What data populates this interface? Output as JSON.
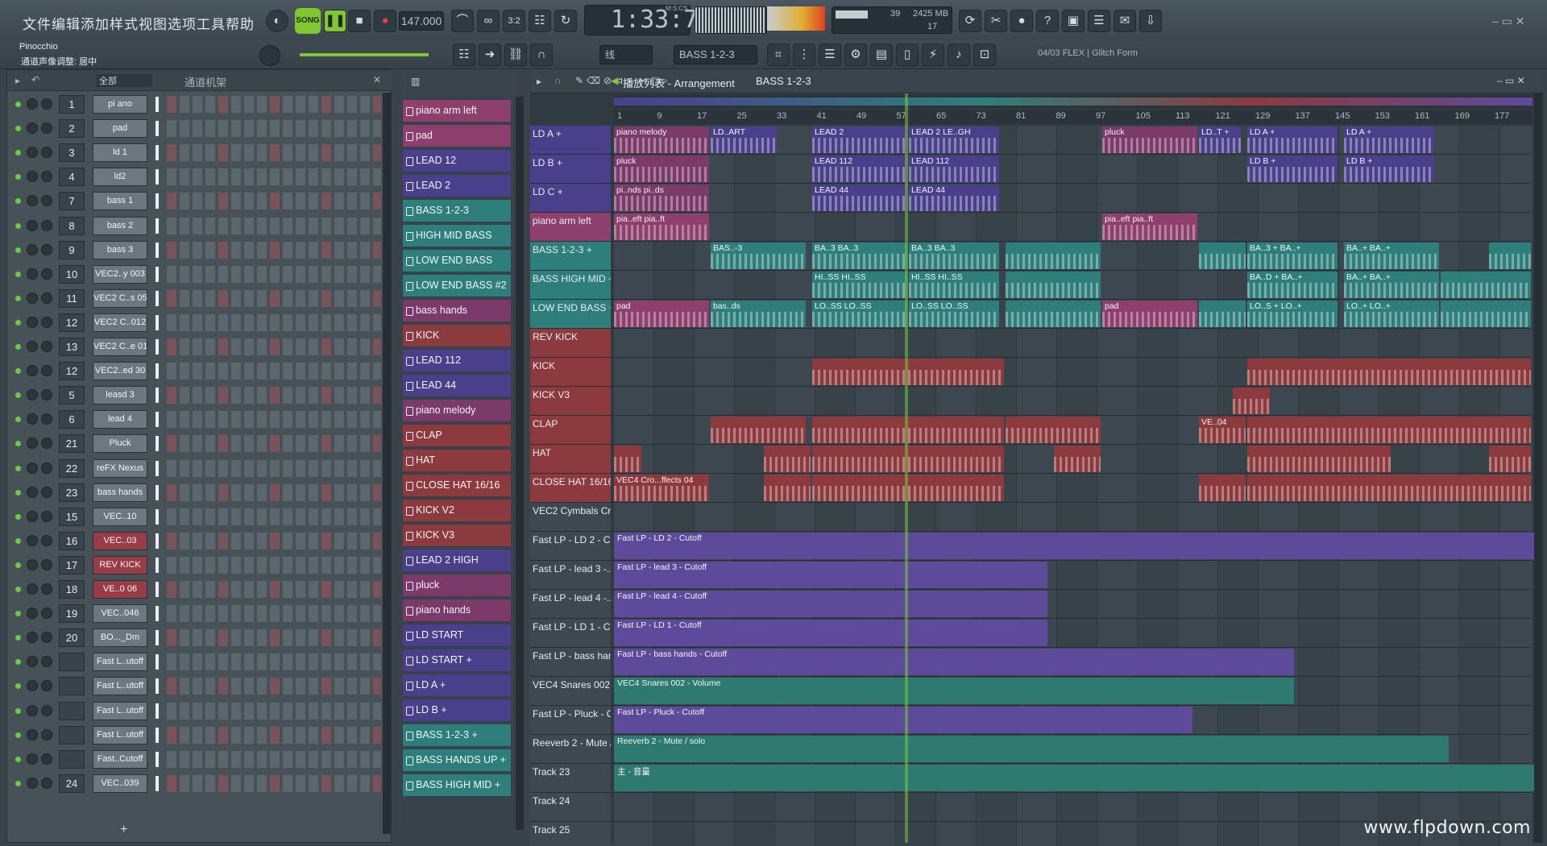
{
  "menu": [
    "文件",
    "编辑",
    "添加",
    "样式",
    "视图",
    "选项",
    "工具",
    "帮助"
  ],
  "transport": {
    "mode": "SONG",
    "tempo": "147.000",
    "time": "1:33:73",
    "time_label": "M:S:CS",
    "cpu": "39",
    "ram": "2425 MB",
    "voices": "17"
  },
  "project": {
    "name": "Pinocchio",
    "hint": "通道声像调整: 居中"
  },
  "toolbar2": {
    "snap": "线",
    "pattern": "BASS 1-2-3",
    "news": "04/03  FLEX | Glitch Form"
  },
  "rack": {
    "title": "通道机架",
    "filter": "全部",
    "channels": [
      {
        "num": "1",
        "name": "pi ano",
        "red": false
      },
      {
        "num": "2",
        "name": "pad",
        "red": false
      },
      {
        "num": "3",
        "name": "ld 1",
        "red": false
      },
      {
        "num": "4",
        "name": "ld2",
        "red": false
      },
      {
        "num": "7",
        "name": "bass 1",
        "red": false
      },
      {
        "num": "8",
        "name": "bass 2",
        "red": false
      },
      {
        "num": "9",
        "name": "bass 3",
        "red": false
      },
      {
        "num": "10",
        "name": "VEC2..y 003",
        "red": false
      },
      {
        "num": "11",
        "name": "VEC2 C..s 051",
        "red": false
      },
      {
        "num": "12",
        "name": "VEC2 C..012",
        "red": false
      },
      {
        "num": "13",
        "name": "VEC2 C..e 01",
        "red": false
      },
      {
        "num": "12",
        "name": "VEC2..ed 30",
        "red": false
      },
      {
        "num": "5",
        "name": "leasd 3",
        "red": false
      },
      {
        "num": "6",
        "name": "lead 4",
        "red": false
      },
      {
        "num": "21",
        "name": "Pluck",
        "red": false
      },
      {
        "num": "22",
        "name": "reFX Nexus",
        "red": false
      },
      {
        "num": "23",
        "name": "bass hands",
        "red": false
      },
      {
        "num": "15",
        "name": "VEC..10",
        "red": false
      },
      {
        "num": "16",
        "name": "VEC..03",
        "red": true
      },
      {
        "num": "17",
        "name": "REV KICK",
        "red": true
      },
      {
        "num": "18",
        "name": "VE..0 06",
        "red": true
      },
      {
        "num": "19",
        "name": "VEC..046",
        "red": false
      },
      {
        "num": "20",
        "name": "BO..._Dm",
        "red": false
      },
      {
        "num": "",
        "name": "Fast L..utoff",
        "red": false
      },
      {
        "num": "",
        "name": "Fast L..utoff",
        "red": false
      },
      {
        "num": "",
        "name": "Fast L..utoff",
        "red": false
      },
      {
        "num": "",
        "name": "Fast L..utoff",
        "red": false
      },
      {
        "num": "",
        "name": "Fast..Cutoff",
        "red": false
      },
      {
        "num": "24",
        "name": "VEC..039",
        "red": false
      }
    ]
  },
  "patterns": [
    {
      "name": "piano arm left",
      "color": "#8e3f6e"
    },
    {
      "name": "pad",
      "color": "#8e3f6e"
    },
    {
      "name": "LEAD 12",
      "color": "#4a3f8a"
    },
    {
      "name": "LEAD 2",
      "color": "#4a3f8a"
    },
    {
      "name": "BASS 1-2-3",
      "color": "#2e7f7c"
    },
    {
      "name": "HIGH MID BASS",
      "color": "#2e7f7c"
    },
    {
      "name": "LOW END BASS",
      "color": "#2e7f7c"
    },
    {
      "name": "LOW END BASS #2",
      "color": "#2e7f7c"
    },
    {
      "name": "bass hands",
      "color": "#7c3a6a"
    },
    {
      "name": "KICK",
      "color": "#8d3a3f"
    },
    {
      "name": "LEAD 112",
      "color": "#4a3f8a"
    },
    {
      "name": "LEAD 44",
      "color": "#4a3f8a"
    },
    {
      "name": "piano melody",
      "color": "#7c3a6a"
    },
    {
      "name": "CLAP",
      "color": "#8d3a3f"
    },
    {
      "name": "HAT",
      "color": "#8d3a3f"
    },
    {
      "name": "CLOSE HAT 16/16",
      "color": "#8d3a3f"
    },
    {
      "name": "KICK V2",
      "color": "#8d3a3f"
    },
    {
      "name": "KICK V3",
      "color": "#8d3a3f"
    },
    {
      "name": "LEAD 2 HIGH",
      "color": "#4a3f8a"
    },
    {
      "name": "pluck",
      "color": "#7c3a6a"
    },
    {
      "name": "piano hands",
      "color": "#7c3a6a"
    },
    {
      "name": "LD START",
      "color": "#4a3f8a"
    },
    {
      "name": "LD START +",
      "color": "#4a3f8a"
    },
    {
      "name": "LD A +",
      "color": "#4a3f8a"
    },
    {
      "name": "LD B +",
      "color": "#4a3f8a"
    },
    {
      "name": "BASS 1-2-3 +",
      "color": "#2e7f7c"
    },
    {
      "name": "BASS HANDS UP +",
      "color": "#2e7f7c"
    },
    {
      "name": "BASS HIGH MID +",
      "color": "#2e7f7c"
    }
  ],
  "playlist": {
    "title": "播放列表 - Arrangement",
    "pattern": "BASS 1-2-3",
    "bars": [
      "1",
      "9",
      "17",
      "25",
      "33",
      "41",
      "49",
      "57",
      "65",
      "73",
      "81",
      "89",
      "97",
      "105",
      "113",
      "121",
      "129",
      "137",
      "145",
      "153",
      "161",
      "169",
      "177"
    ],
    "tracks": [
      {
        "name": "LD A +",
        "color": "#4a3f8a",
        "clips": [
          {
            "at": 0,
            "len": 100,
            "label": "piano melody",
            "c": "#7c3a6a"
          },
          {
            "at": 100,
            "len": 70,
            "label": "LD..ART"
          },
          {
            "at": 205,
            "len": 100,
            "label": "LEAD 2"
          },
          {
            "at": 305,
            "len": 95,
            "label": "LEAD 2 LE..GH"
          },
          {
            "at": 505,
            "len": 100,
            "label": "pluck",
            "c": "#7c3a6a"
          },
          {
            "at": 605,
            "len": 45,
            "label": "LD..T +"
          },
          {
            "at": 655,
            "len": 95,
            "label": "LD A +"
          },
          {
            "at": 755,
            "len": 95,
            "label": "LD A +"
          }
        ]
      },
      {
        "name": "LD B +",
        "color": "#4a3f8a",
        "clips": [
          {
            "at": 0,
            "len": 100,
            "label": "pluck",
            "c": "#7c3a6a"
          },
          {
            "at": 205,
            "len": 100,
            "label": "LEAD 112"
          },
          {
            "at": 305,
            "len": 95,
            "label": "LEAD 112"
          },
          {
            "at": 655,
            "len": 95,
            "label": "LD B +"
          },
          {
            "at": 755,
            "len": 95,
            "label": "LD B +"
          }
        ]
      },
      {
        "name": "LD C +",
        "color": "#4a3f8a",
        "clips": [
          {
            "at": 0,
            "len": 100,
            "label": "pi..nds  pi..ds",
            "c": "#7c3a6a"
          },
          {
            "at": 205,
            "len": 100,
            "label": "LEAD 44"
          },
          {
            "at": 305,
            "len": 95,
            "label": "LEAD 44"
          }
        ]
      },
      {
        "name": "piano arm left",
        "color": "#8e3f6e",
        "clips": [
          {
            "at": 0,
            "len": 100,
            "label": "pia..eft  pia..ft"
          },
          {
            "at": 505,
            "len": 100,
            "label": "pia..eft  pia..ft"
          }
        ]
      },
      {
        "name": "BASS 1-2-3 +",
        "color": "#2e7f7c",
        "clips": [
          {
            "at": 100,
            "len": 100,
            "label": "BAS..-3"
          },
          {
            "at": 205,
            "len": 100,
            "label": "BA..3  BA..3"
          },
          {
            "at": 305,
            "len": 95,
            "label": "BA..3  BA..3"
          },
          {
            "at": 405,
            "len": 100,
            "label": ""
          },
          {
            "at": 605,
            "len": 50,
            "label": ""
          },
          {
            "at": 655,
            "len": 95,
            "label": "BA..3 +  BA..+"
          },
          {
            "at": 755,
            "len": 100,
            "label": "BA..+  BA..+"
          },
          {
            "at": 905,
            "len": 45,
            "label": ""
          }
        ]
      },
      {
        "name": "BASS HIGH MID +",
        "color": "#2e7f7c",
        "clips": [
          {
            "at": 205,
            "len": 100,
            "label": "HI..SS  HI..SS"
          },
          {
            "at": 305,
            "len": 95,
            "label": "HI..SS  HI..SS"
          },
          {
            "at": 405,
            "len": 100,
            "label": ""
          },
          {
            "at": 655,
            "len": 95,
            "label": "BA..D +  BA..+"
          },
          {
            "at": 755,
            "len": 100,
            "label": "BA..+  BA..+"
          },
          {
            "at": 855,
            "len": 95,
            "label": ""
          }
        ]
      },
      {
        "name": "LOW END BASS +",
        "color": "#2e7f7c",
        "clips": [
          {
            "at": 0,
            "len": 100,
            "label": "pad",
            "c": "#8e3f6e"
          },
          {
            "at": 100,
            "len": 100,
            "label": "bas..ds"
          },
          {
            "at": 205,
            "len": 100,
            "label": "LO..SS  LO..SS"
          },
          {
            "at": 305,
            "len": 95,
            "label": "LO..SS  LO..SS"
          },
          {
            "at": 405,
            "len": 100,
            "label": ""
          },
          {
            "at": 505,
            "len": 100,
            "label": "pad",
            "c": "#8e3f6e"
          },
          {
            "at": 605,
            "len": 50,
            "label": ""
          },
          {
            "at": 655,
            "len": 95,
            "label": "LO..S +  LO..+"
          },
          {
            "at": 755,
            "len": 100,
            "label": "LO..+  LO..+"
          },
          {
            "at": 855,
            "len": 95,
            "label": ""
          }
        ]
      },
      {
        "name": "REV KICK",
        "color": "#8d3a3f",
        "clips": []
      },
      {
        "name": "KICK",
        "color": "#8d3a3f",
        "clips": [
          {
            "at": 205,
            "len": 200,
            "label": ""
          },
          {
            "at": 655,
            "len": 295,
            "label": ""
          }
        ]
      },
      {
        "name": "KICK V3",
        "color": "#8d3a3f",
        "clips": [
          {
            "at": 640,
            "len": 40,
            "label": ""
          }
        ]
      },
      {
        "name": "CLAP",
        "color": "#8d3a3f",
        "clips": [
          {
            "at": 100,
            "len": 100,
            "label": ""
          },
          {
            "at": 205,
            "len": 200,
            "label": ""
          },
          {
            "at": 405,
            "len": 100,
            "label": ""
          },
          {
            "at": 605,
            "len": 50,
            "label": "VE..04"
          },
          {
            "at": 655,
            "len": 295,
            "label": ""
          }
        ]
      },
      {
        "name": "HAT",
        "color": "#8d3a3f",
        "clips": [
          {
            "at": 0,
            "len": 30,
            "label": ""
          },
          {
            "at": 155,
            "len": 50,
            "label": ""
          },
          {
            "at": 205,
            "len": 200,
            "label": ""
          },
          {
            "at": 455,
            "len": 50,
            "label": ""
          },
          {
            "at": 655,
            "len": 150,
            "label": ""
          },
          {
            "at": 905,
            "len": 45,
            "label": ""
          }
        ]
      },
      {
        "name": "CLOSE HAT 16/16",
        "color": "#8d3a3f",
        "clips": [
          {
            "at": 0,
            "len": 100,
            "label": "VEC4 Cro...ffects 04"
          },
          {
            "at": 155,
            "len": 50,
            "label": ""
          },
          {
            "at": 205,
            "len": 200,
            "label": ""
          },
          {
            "at": 605,
            "len": 50,
            "label": ""
          },
          {
            "at": 655,
            "len": 295,
            "label": ""
          }
        ]
      },
      {
        "name": "VEC2 Cymbals Cras...",
        "color": "#3d4850",
        "clips": []
      }
    ],
    "automation": [
      {
        "name": "Fast LP - LD 2 - Cu...",
        "label": "Fast LP - LD 2 - Cutoff",
        "len": 955,
        "c": "#5d4a9a"
      },
      {
        "name": "Fast LP - lead 3 -...",
        "label": "Fast LP - lead 3 - Cutoff",
        "len": 450,
        "c": "#5d4a9a"
      },
      {
        "name": "Fast LP - lead 4 -...",
        "label": "Fast LP - lead 4 - Cutoff",
        "len": 450,
        "c": "#5d4a9a"
      },
      {
        "name": "Fast LP - LD 1 - Cu...",
        "label": "Fast LP - LD 1 - Cutoff",
        "len": 450,
        "c": "#5d4a9a"
      },
      {
        "name": "Fast LP - bass han...",
        "label": "Fast LP - bass hands - Cutoff",
        "len": 705,
        "c": "#5d4a9a"
      },
      {
        "name": "VEC4 Snares 002 -...",
        "label": "VEC4 Snares 002 - Volume",
        "len": 705,
        "c": "#2f7a70"
      },
      {
        "name": "Fast LP - Pluck - C...",
        "label": "Fast LP - Pluck - Cutoff",
        "len": 600,
        "c": "#5d4a9a"
      },
      {
        "name": "Reeverb 2 - Mute /...",
        "label": "Reeverb 2 - Mute / solo",
        "len": 865,
        "c": "#2f7a70"
      },
      {
        "name": "Track 23",
        "label": "主 - 音量",
        "len": 955,
        "c": "#2f7a70"
      },
      {
        "name": "Track 24",
        "label": "",
        "len": 0,
        "c": "#303a41"
      },
      {
        "name": "Track 25",
        "label": "",
        "len": 0,
        "c": "#303a41"
      }
    ]
  },
  "watermark": "www.flpdown.com"
}
